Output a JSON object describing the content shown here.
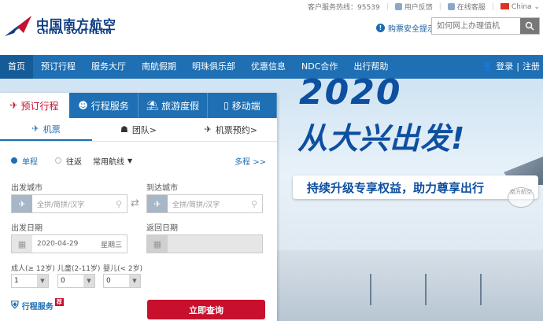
{
  "header": {
    "logo_cn": "中国南方航空",
    "logo_en": "CHINA SOUTHERN",
    "hotline": "客户服务热线：95539",
    "feedback": "用户反馈",
    "online_service": "在线客服",
    "region": "China",
    "safety_tip": "购票安全提示",
    "search_placeholder": "如何网上办理值机"
  },
  "nav": {
    "items": [
      "首页",
      "预订行程",
      "服务大厅",
      "南航假期",
      "明珠俱乐部",
      "优惠信息",
      "NDC合作",
      "出行帮助"
    ],
    "login": "登录",
    "register": "注册"
  },
  "banner": {
    "year": "2020",
    "slogan": "从大兴出发!",
    "sub": "持续升级专享权益，助力尊享出行",
    "stamp": "南方航空"
  },
  "booking": {
    "tabs": [
      "预订行程",
      "行程服务",
      "旅游度假",
      "移动端"
    ],
    "subtabs": [
      "机票",
      "团队>",
      "机票预约>"
    ],
    "trip_types": [
      "单程",
      "往返"
    ],
    "common_routes": "常用航线",
    "multi_city": "多程 >>",
    "origin_label": "出发城市",
    "dest_label": "到达城市",
    "city_placeholder": "全拼/简拼/汉字",
    "depart_label": "出发日期",
    "return_label": "返回日期",
    "depart_date": "2020-04-29",
    "depart_weekday": "星期三",
    "adult_label": "成人(≥ 12岁)",
    "child_label": "儿童(2-11岁)",
    "infant_label": "婴儿(< 2岁)",
    "adult_value": "1",
    "child_value": "0",
    "infant_value": "0",
    "service_link": "行程服务",
    "service_badge": "荐",
    "search_button": "立即查询"
  },
  "colors": {
    "brand_blue": "#1e6fb3",
    "accent_red": "#c8102e"
  }
}
